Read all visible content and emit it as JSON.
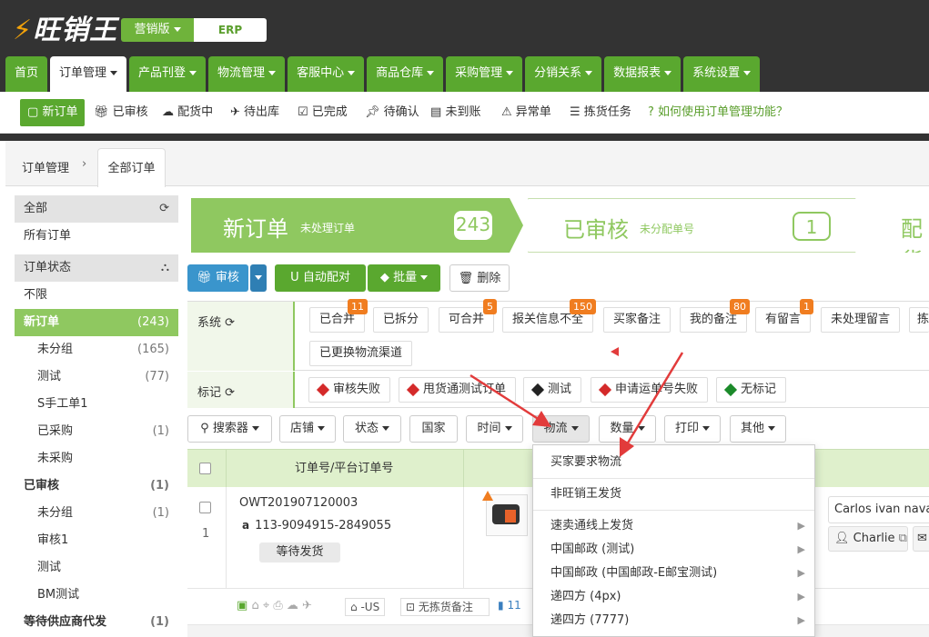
{
  "brand": {
    "logo": "旺销王",
    "edition": "营销版",
    "erp": "ERP"
  },
  "mainnav": [
    {
      "label": "首页",
      "caret": false
    },
    {
      "label": "订单管理",
      "caret": true
    },
    {
      "label": "产品刊登",
      "caret": true
    },
    {
      "label": "物流管理",
      "caret": true
    },
    {
      "label": "客服中心",
      "caret": true
    },
    {
      "label": "商品仓库",
      "caret": true
    },
    {
      "label": "采购管理",
      "caret": true
    },
    {
      "label": "分销关系",
      "caret": true
    },
    {
      "label": "数据报表",
      "caret": true
    },
    {
      "label": "系统设置",
      "caret": true
    }
  ],
  "subnav": [
    {
      "label": "新订单",
      "icon": "document-icon"
    },
    {
      "label": "已审核",
      "icon": "gift-icon"
    },
    {
      "label": "配货中",
      "icon": "cloud-upload-icon"
    },
    {
      "label": "待出库",
      "icon": "plane-icon"
    },
    {
      "label": "已完成",
      "icon": "check-square-icon"
    },
    {
      "label": "待确认",
      "icon": "pin-icon"
    },
    {
      "label": "未到账",
      "icon": "credit-card-icon"
    },
    {
      "label": "异常单",
      "icon": "warning-icon"
    },
    {
      "label": "拣货任务",
      "icon": "tasks-icon"
    },
    {
      "label": "如何使用订单管理功能？",
      "icon": "question-icon"
    }
  ],
  "breadcrumb": {
    "root": "订单管理",
    "separator": "›",
    "current": "全部订单"
  },
  "sidebar": {
    "all": "全部",
    "all_orders": "所有订单",
    "status_header": "订单状态",
    "items": [
      {
        "label": "不限",
        "count": ""
      },
      {
        "label": "新订单",
        "count": "(243)"
      },
      {
        "label": "未分组",
        "count": "(165)"
      },
      {
        "label": "测试",
        "count": "(77)"
      },
      {
        "label": "S手工单1",
        "count": ""
      },
      {
        "label": "已采购",
        "count": "(1)"
      },
      {
        "label": "未采购",
        "count": ""
      },
      {
        "label": "已审核",
        "count": "(1)"
      },
      {
        "label": "未分组",
        "count": "(1)"
      },
      {
        "label": "审核1",
        "count": ""
      },
      {
        "label": "测试",
        "count": ""
      },
      {
        "label": "BM测试",
        "count": ""
      },
      {
        "label": "等待供应商代发",
        "count": "(1)"
      }
    ]
  },
  "funnel": {
    "step1": {
      "title": "新订单",
      "subtitle": "未处理订单",
      "count": "243"
    },
    "step2": {
      "title": "已审核",
      "subtitle": "未分配单号",
      "count": "1"
    },
    "step3": {
      "title": "配货"
    }
  },
  "actions": {
    "review": "审核",
    "auto_match": "自动配对",
    "batch": "批量",
    "delete": "删除"
  },
  "filters": {
    "system_label": "系统",
    "system_chips": [
      {
        "label": "已合并",
        "badge": "11"
      },
      {
        "label": "已拆分",
        "badge": ""
      },
      {
        "label": "可合并",
        "badge": "5"
      },
      {
        "label": "报关信息不全",
        "badge": "150"
      },
      {
        "label": "买家备注",
        "badge": ""
      },
      {
        "label": "我的备注",
        "badge": "80"
      },
      {
        "label": "有留言",
        "badge": "1"
      },
      {
        "label": "未处理留言",
        "badge": ""
      },
      {
        "label": "拣",
        "badge": ""
      },
      {
        "label": "已更换物流渠道",
        "badge": ""
      }
    ],
    "mark_label": "标记",
    "mark_chips": [
      {
        "label": "审核失败",
        "color": "#d42a2a"
      },
      {
        "label": "甩货通测试订单",
        "color": "#d42a2a"
      },
      {
        "label": "测试",
        "color": "#222222"
      },
      {
        "label": "申请运单号失败",
        "color": "#d42a2a"
      },
      {
        "label": "无标记",
        "color": "#1b8a2a"
      }
    ]
  },
  "tools": [
    "搜索器",
    "店铺",
    "状态",
    "国家",
    "时间",
    "物流",
    "数量",
    "打印",
    "其他"
  ],
  "table": {
    "header": "订单号/平台订单号",
    "row": {
      "index": "1",
      "order_no": "OWT201907120003",
      "platform_no": "113-9094915-2849055",
      "status": "等待发货",
      "customer": "Carlos ivan navar",
      "account": "Charlie",
      "country": "-US",
      "note": "无拣货备注",
      "extra": "11"
    }
  },
  "dropdown": [
    {
      "label": "买家要求物流",
      "arrow": false,
      "sep_after": true
    },
    {
      "label": "非旺销王发货",
      "arrow": false,
      "sep_after": true
    },
    {
      "label": "速卖通线上发货",
      "arrow": true,
      "sep_after": false
    },
    {
      "label": "中国邮政 (测试)",
      "arrow": true,
      "sep_after": false
    },
    {
      "label": "中国邮政 (中国邮政-E邮宝测试)",
      "arrow": true,
      "sep_after": false
    },
    {
      "label": "递四方 (4px)",
      "arrow": true,
      "sep_after": false
    },
    {
      "label": "递四方 (7777)",
      "arrow": true,
      "sep_after": false
    }
  ]
}
